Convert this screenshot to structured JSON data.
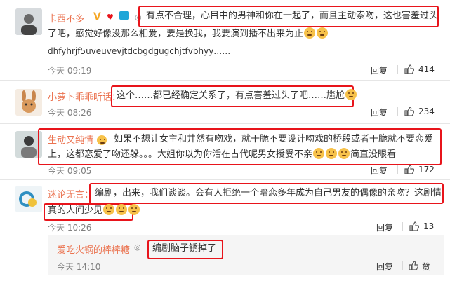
{
  "comments": [
    {
      "user": "卡西不多",
      "text_line1": "有点不合理，心目中的男神和你在一起了，而且主动索吻，这也害羞过头",
      "text_line2": "了吧，感觉好像没那么相爱，要是换我，我要演到播不出来为止",
      "text_line3": "dhfyhrjf5uveuvevjtdcbgdgugchjtfvbhyy……",
      "time": "今天 09:19",
      "reply": "回复",
      "likes": "414"
    },
    {
      "user": "小萝卜乖乖听话：",
      "text_line1": "这个……都已经确定关系了，有点害羞过头了吧……尴尬",
      "time": "今天 08:26",
      "reply": "回复",
      "likes": "234"
    },
    {
      "user": "生动又纯情",
      "text_line1": "如果不想让女主和井然有吻戏，就干脆不要设计吻戏的桥段或者干脆就不要恋爱",
      "text_line2": "上，这都恋爱了吻还躲。。。大姐你以为你活在古代呢男女授受不亲",
      "text_line2b": "简直没眼看",
      "time": "今天 09:05",
      "reply": "回复",
      "likes": "172"
    },
    {
      "user": "迷论无言：",
      "text_line1": "编剧，出来，我们谈谈。会有人拒绝一个暗恋多年成为自己男友的偶像的亲吻？这剧情",
      "text_line2": "真的人间少见",
      "time": "今天 10:26",
      "reply": "回复",
      "likes": "13"
    }
  ],
  "subreply": {
    "user": "爱吃火锅的棒棒糖",
    "text": "编剧脑子锈掉了",
    "time": "今天 14:10",
    "reply": "回复",
    "likes": "赞"
  },
  "colors": {
    "username": "#eb7350",
    "highlight": "#e8141b",
    "muted": "#808080"
  }
}
